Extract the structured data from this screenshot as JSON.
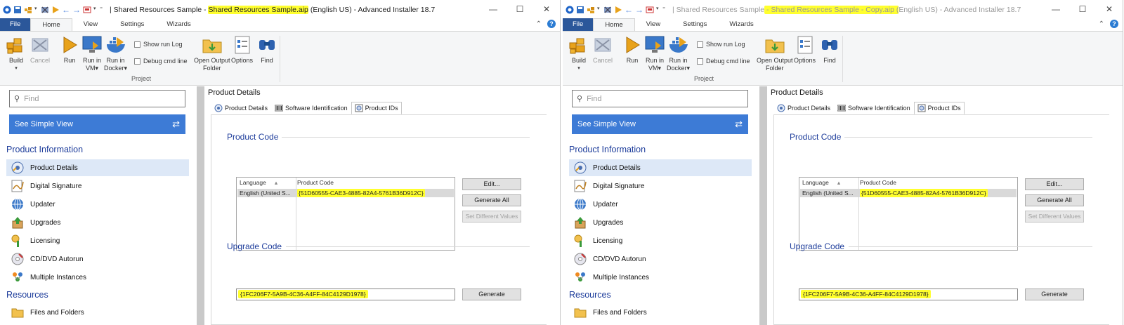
{
  "windows": [
    {
      "title_prefix": "Shared Resources Sample - ",
      "title_highlight": "Shared Resources Sample.aip",
      "title_suffix": " (English US) - Advanced Installer 18.7",
      "active": true
    },
    {
      "title_prefix": "Shared Resources Sample",
      "title_highlight": " - Shared Resources Sample - Copy.aip (",
      "title_suffix": "English US) - Advanced Installer 18.7",
      "active": false
    }
  ],
  "ribbon": {
    "tabs": [
      "File",
      "Home",
      "View",
      "Settings",
      "Wizards"
    ],
    "active_tab": "Home",
    "buttons": {
      "build": "Build",
      "cancel": "Cancel",
      "run": "Run",
      "run_vm_1": "Run in",
      "run_vm_2": "VM",
      "run_docker_1": "Run in",
      "run_docker_2": "Docker",
      "open_output_1": "Open Output",
      "open_output_2": "Folder",
      "options": "Options",
      "find": "Find"
    },
    "checkboxes": {
      "show_run_log": "Show run Log",
      "debug_cmd_line": "Debug cmd line"
    },
    "group_label": "Project"
  },
  "left_pane": {
    "find_placeholder": "Find",
    "simple_view": "See Simple View",
    "section_product_info": "Product Information",
    "items": [
      "Product Details",
      "Digital Signature",
      "Updater",
      "Upgrades",
      "Licensing",
      "CD/DVD Autorun",
      "Multiple Instances"
    ],
    "section_resources": "Resources",
    "resources_items": [
      "Files and Folders"
    ],
    "selected": "Product Details"
  },
  "right_pane": {
    "header": "Product Details",
    "subtabs": [
      "Product Details",
      "Software Identification",
      "Product IDs"
    ],
    "active_subtab": "Product IDs",
    "product_code_group": "Product Code",
    "list_headers": {
      "language": "Language",
      "product_code": "Product Code"
    },
    "row": {
      "language": "English (United S...",
      "code": "{51D60555-CAE3-4885-82A4-5761B36D912C}"
    },
    "buttons": {
      "edit": "Edit...",
      "generate_all": "Generate All",
      "set_different": "Set Different Values",
      "generate": "Generate"
    },
    "upgrade_code_group": "Upgrade Code",
    "upgrade_code": "{1FC206F7-5A9B-4C36-A4FF-84C4129D1978}"
  },
  "colors": {
    "highlight": "#ffff2e",
    "accent_blue": "#3d7bd6",
    "section_blue": "#1e3d9b",
    "file_tab": "#2b579a"
  }
}
